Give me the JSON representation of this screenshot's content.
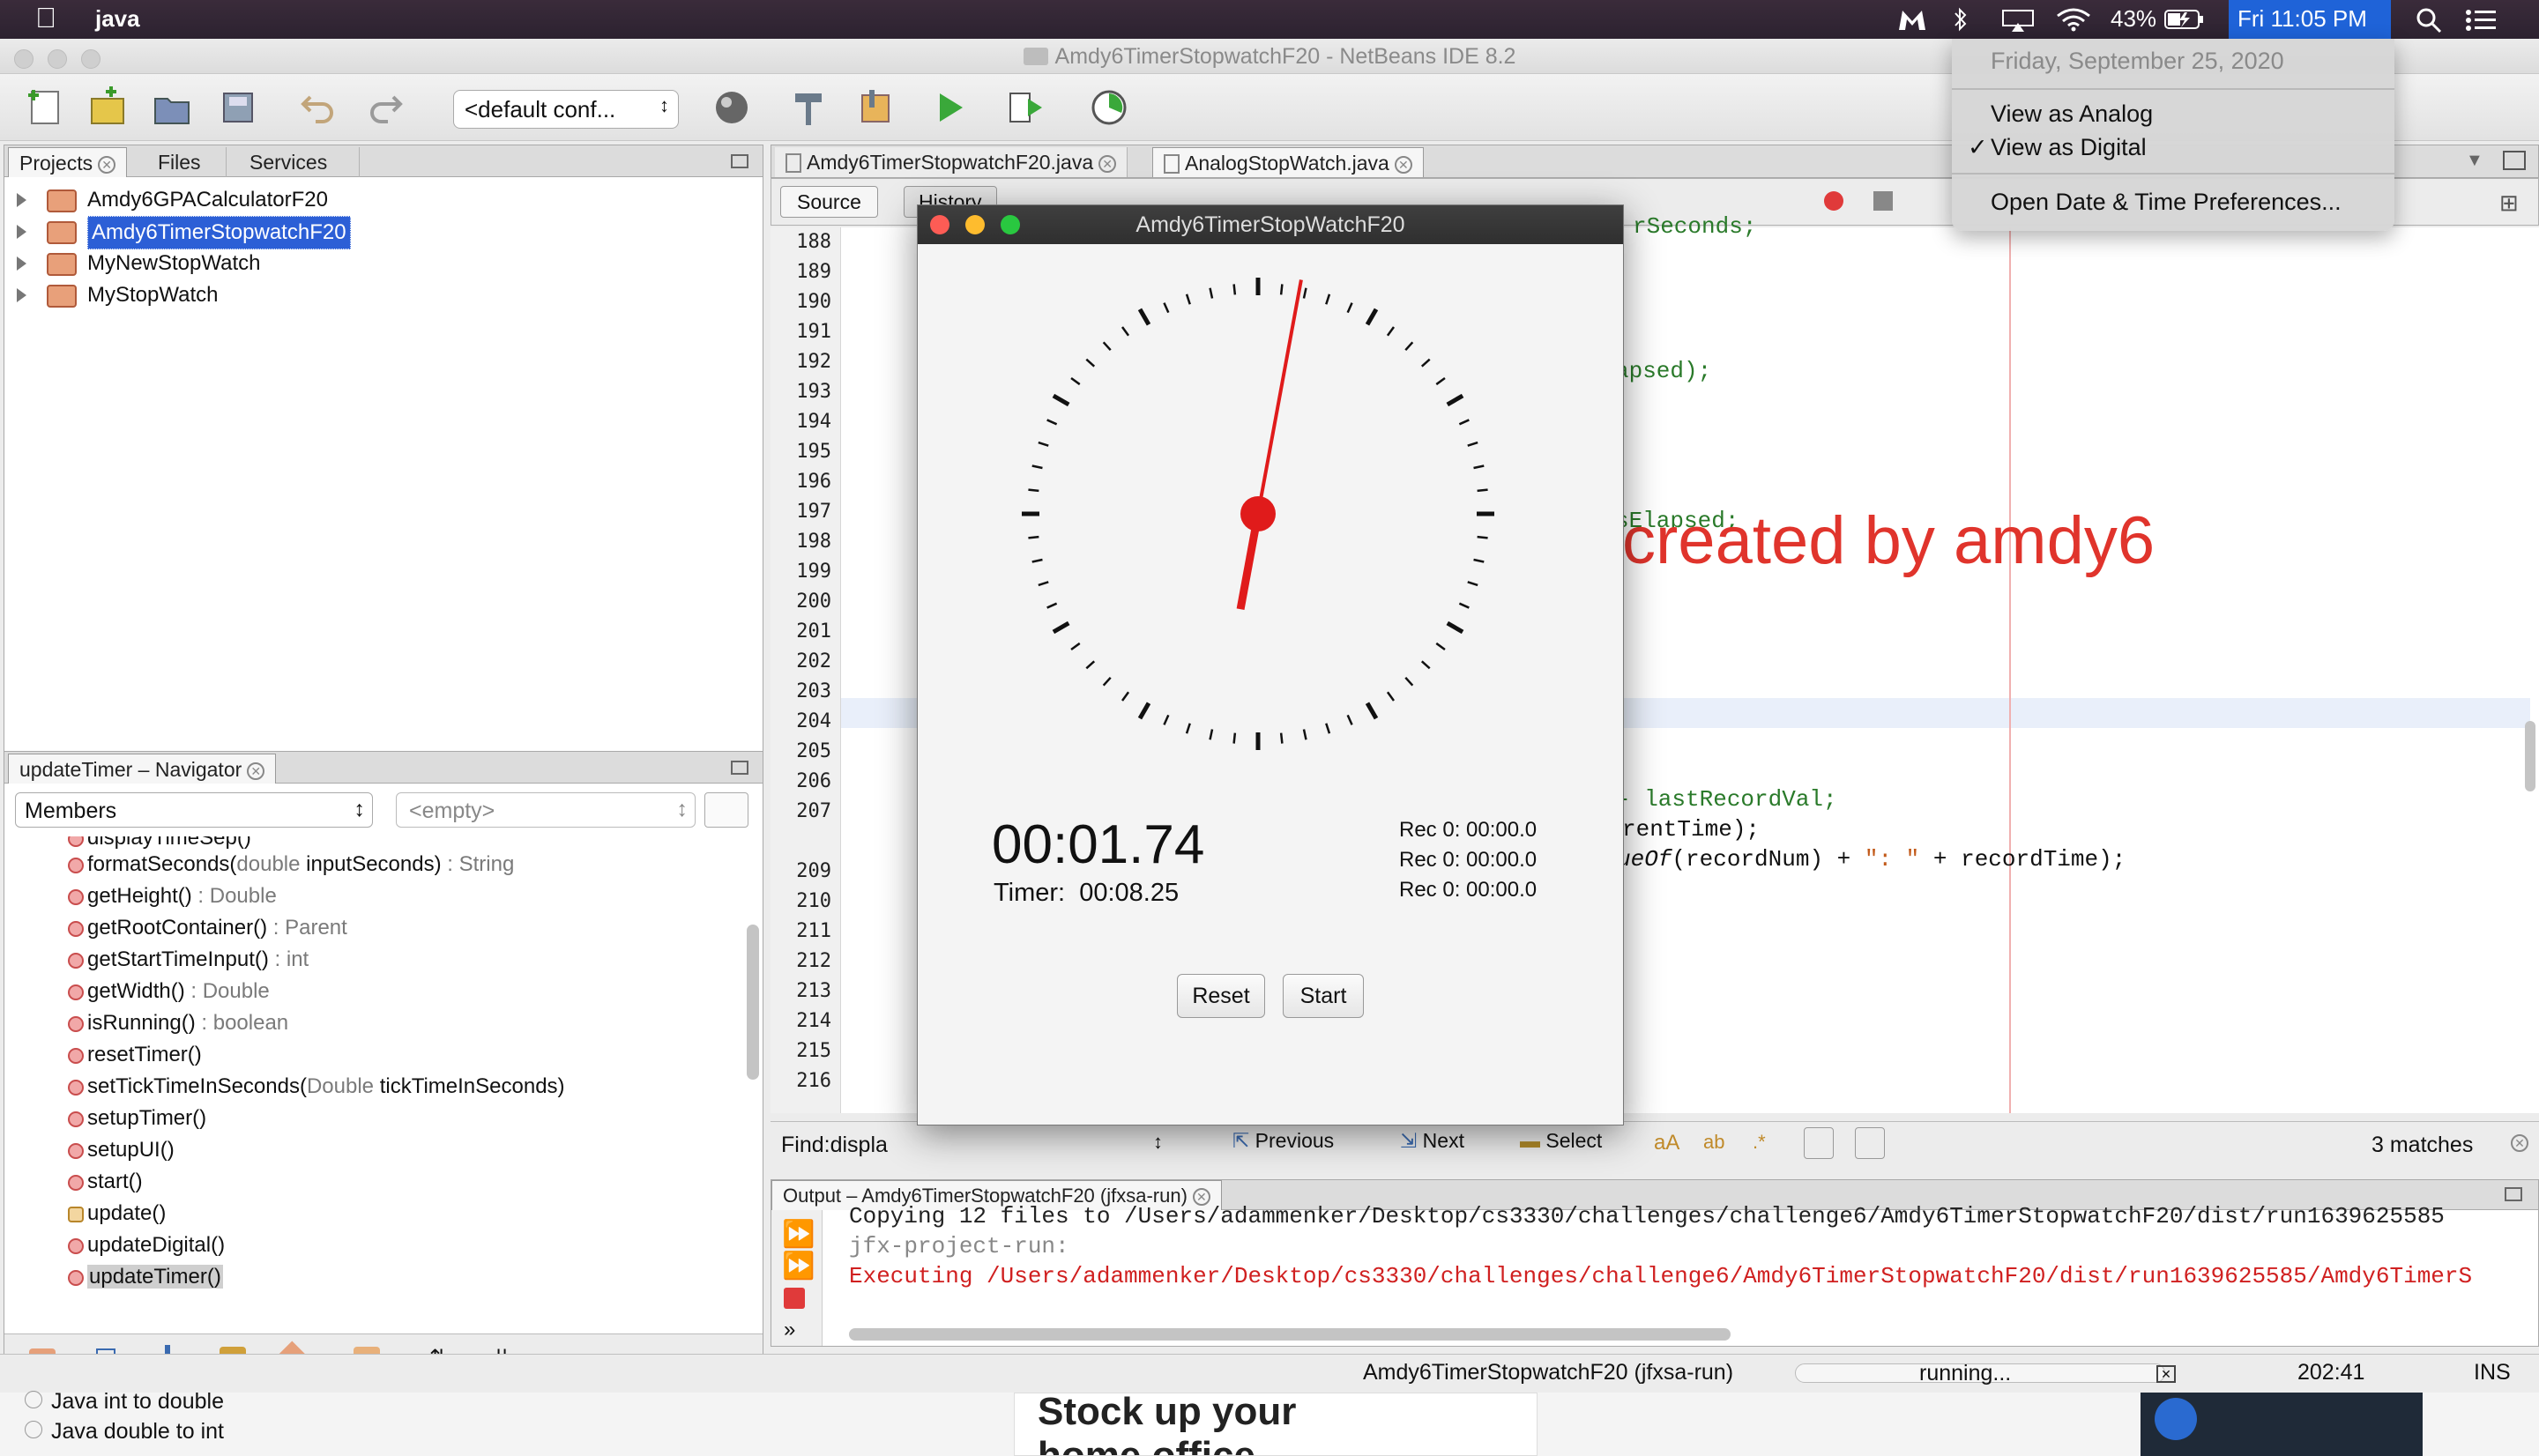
{
  "menubar": {
    "app_name": "java",
    "battery": "43%",
    "clock": "Fri 11:05 PM"
  },
  "window": {
    "title": "Amdy6TimerStopwatchF20 - NetBeans IDE 8.2",
    "config_select": "<default conf..."
  },
  "projects_panel": {
    "tabs": [
      "Projects",
      "Files",
      "Services"
    ],
    "items": [
      {
        "label": "Amdy6GPACalculatorF20"
      },
      {
        "label": "Amdy6TimerStopwatchF20"
      },
      {
        "label": "MyNewStopWatch"
      },
      {
        "label": "MyStopWatch"
      }
    ]
  },
  "navigator": {
    "title": "updateTimer – Navigator",
    "filter": "Members",
    "filter2": "<empty>",
    "partial_top": "displayTimeSep()",
    "items": [
      {
        "name": "formatSeconds(",
        "param_type": "double",
        "param_name": " inputSeconds)",
        "ret": " : String"
      },
      {
        "name": "getHeight()",
        "ret": " : Double"
      },
      {
        "name": "getRootContainer()",
        "ret": " : Parent"
      },
      {
        "name": "getStartTimeInput()",
        "ret": " : int"
      },
      {
        "name": "getWidth()",
        "ret": " : Double"
      },
      {
        "name": "isRunning()",
        "ret": " : boolean"
      },
      {
        "name": "resetTimer()",
        "ret": ""
      },
      {
        "name": "setTickTimeInSeconds(",
        "param_type": "Double",
        "param_name": " tickTimeInSeconds)",
        "ret": ""
      },
      {
        "name": "setupTimer()",
        "ret": ""
      },
      {
        "name": "setupUI()",
        "ret": ""
      },
      {
        "name": "start()",
        "ret": ""
      },
      {
        "name": "update()",
        "ret": ""
      },
      {
        "name": "updateDigital()",
        "ret": ""
      },
      {
        "name": "updateTimer()",
        "ret": ""
      }
    ]
  },
  "editor": {
    "tabs": [
      "Amdy6TimerStopwatchF20.java",
      "AnalogStopWatch.java"
    ],
    "subtabs": [
      "Source",
      "History"
    ],
    "line_numbers": [
      "188",
      "189",
      "190",
      "191",
      "192",
      "193",
      "194",
      "195",
      "196",
      "197",
      "198",
      "199",
      "200",
      "201",
      "202",
      "203",
      "204",
      "205",
      "206",
      "207",
      "",
      "209",
      "210",
      "211",
      "212",
      "213",
      "214",
      "215",
      "216"
    ],
    "partial_code_1": "apsed);",
    "partial_code_2": "sElapsed;",
    "partial_code_3": "- lastRecordVal;",
    "partial_code_4": "rentTime);",
    "partial_code_5a": "ueOf",
    "partial_code_5b": "(recordNum) + ",
    "partial_code_5c": "\": \"",
    "partial_code_5d": " + recordTime);",
    "partial_code_top": "rSeconds;",
    "watermark": "created by amdy6"
  },
  "findbar": {
    "label": "Find:",
    "value": "displa",
    "previous": "Previous",
    "next": "Next",
    "select": "Select",
    "matches": "3 matches"
  },
  "output": {
    "title": "Output – Amdy6TimerStopwatchF20 (jfxsa-run)",
    "lines": [
      "Copying 12 files to /Users/adammenker/Desktop/cs3330/challenges/challenge6/Amdy6TimerStopwatchF20/dist/run1639625585",
      "jfx-project-run:",
      "Executing /Users/adammenker/Desktop/cs3330/challenges/challenge6/Amdy6TimerStopwatchF20/dist/run1639625585/Amdy6TimerS"
    ]
  },
  "statusbar": {
    "task": "Amdy6TimerStopwatchF20 (jfxsa-run)",
    "state": "running...",
    "position": "202:41",
    "mode": "INS"
  },
  "background_content": {
    "link1": "Java int to double",
    "link2": "Java double to int",
    "ad": "Stock up your home office"
  },
  "stopwatch_app": {
    "title": "Amdy6TimerStopWatchF20",
    "elapsed": "00:01.74",
    "timer_label": "Timer:",
    "timer_value": "00:08.25",
    "records": [
      "Rec 0: 00:00.0",
      "Rec 0: 00:00.0",
      "Rec 0: 00:00.0"
    ],
    "reset_button": "Reset",
    "start_button": "Start",
    "hand_seconds": 1.74,
    "hand_color": "#e01b1b"
  },
  "datetime_menu": {
    "date": "Friday, September 25, 2020",
    "items": [
      "View as Analog",
      "View as Digital",
      "Open Date & Time Preferences..."
    ],
    "checked": "View as Digital",
    "checkmark": "✓"
  }
}
